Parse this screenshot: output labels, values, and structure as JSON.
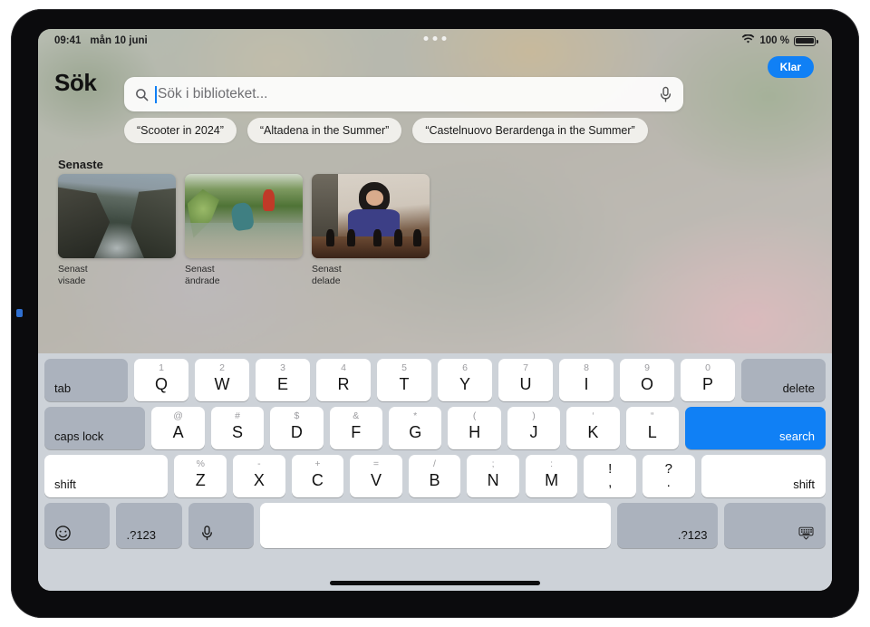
{
  "status_bar": {
    "time": "09:41",
    "date": "mån 10 juni",
    "wifi_icon": "wifi-icon",
    "battery_percent": "100 %",
    "battery_icon": "battery-icon",
    "multitask_icon": "multitasking-dots-icon"
  },
  "header": {
    "title": "Sök",
    "done_label": "Klar"
  },
  "search": {
    "placeholder": "Sök i biblioteket...",
    "value": "",
    "search_icon": "search-icon",
    "mic_icon": "microphone-icon"
  },
  "suggestions": [
    {
      "label": "“Scooter in 2024”"
    },
    {
      "label": "“Altadena in the Summer”"
    },
    {
      "label": "“Castelnuovo Berardenga in the Summer”"
    }
  ],
  "recents": {
    "title": "Senaste",
    "items": [
      {
        "caption_line1": "Senast",
        "caption_line2": "visade",
        "photo": "coastal-cliffs-photo"
      },
      {
        "caption_line1": "Senast",
        "caption_line2": "ändrade",
        "photo": "person-in-creek-photo"
      },
      {
        "caption_line1": "Senast",
        "caption_line2": "delade",
        "photo": "girl-playing-chess-photo"
      }
    ]
  },
  "keyboard": {
    "rows": {
      "row_numbers": {
        "tab": "tab",
        "keys": [
          {
            "sec": "1",
            "main": "Q"
          },
          {
            "sec": "2",
            "main": "W"
          },
          {
            "sec": "3",
            "main": "E"
          },
          {
            "sec": "4",
            "main": "R"
          },
          {
            "sec": "5",
            "main": "T"
          },
          {
            "sec": "6",
            "main": "Y"
          },
          {
            "sec": "7",
            "main": "U"
          },
          {
            "sec": "8",
            "main": "I"
          },
          {
            "sec": "9",
            "main": "O"
          },
          {
            "sec": "0",
            "main": "P"
          }
        ],
        "delete": "delete"
      },
      "row_home": {
        "caps_lock": "caps lock",
        "keys": [
          {
            "sec": "@",
            "main": "A"
          },
          {
            "sec": "#",
            "main": "S"
          },
          {
            "sec": "$",
            "main": "D"
          },
          {
            "sec": "&",
            "main": "F"
          },
          {
            "sec": "*",
            "main": "G"
          },
          {
            "sec": "(",
            "main": "H"
          },
          {
            "sec": ")",
            "main": "J"
          },
          {
            "sec": "‘",
            "main": "K"
          },
          {
            "sec": "“",
            "main": "L"
          }
        ],
        "return": "search"
      },
      "row_shift": {
        "shift_left": "shift",
        "keys": [
          {
            "sec": "%",
            "main": "Z"
          },
          {
            "sec": "-",
            "main": "X"
          },
          {
            "sec": "+",
            "main": "C"
          },
          {
            "sec": "=",
            "main": "V"
          },
          {
            "sec": "/",
            "main": "B"
          },
          {
            "sec": ";",
            "main": "N"
          },
          {
            "sec": ":",
            "main": "M"
          }
        ],
        "punct": [
          {
            "top": "!",
            "bot": ","
          },
          {
            "top": "?",
            "bot": "."
          }
        ],
        "shift_right": "shift"
      },
      "row_bottom": {
        "emoji_icon": "emoji-smiley-icon",
        "numeric_left": ".?123",
        "mic_icon": "microphone-icon",
        "space": "",
        "numeric_right": ".?123",
        "dismiss_icon": "dismiss-keyboard-icon"
      }
    }
  },
  "colors": {
    "accent_blue": "#1080f5",
    "keyboard_bg": "#cdd2d8",
    "key_white": "#ffffff",
    "key_gray": "#abb2bd"
  }
}
